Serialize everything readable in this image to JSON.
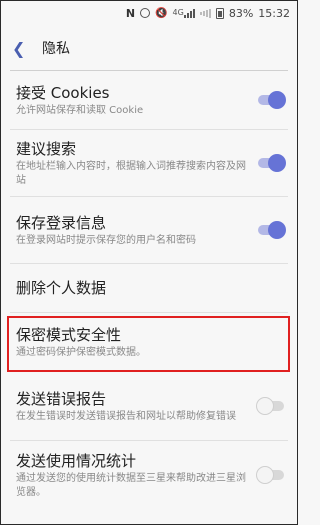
{
  "status_bar": {
    "nfc": "N",
    "signal_label": "4G",
    "battery_pct": "83%",
    "time": "15:32"
  },
  "header": {
    "back_icon": "back-chevron-icon",
    "title": "隐私"
  },
  "items": [
    {
      "title": "接受 Cookies",
      "subtitle": "允许网站保存和读取 Cookie",
      "toggle": "on"
    },
    {
      "title": "建议搜索",
      "subtitle": "在地址栏输入内容时，根据输入词推荐搜索内容及网站",
      "toggle": "on"
    },
    {
      "title": "保存登录信息",
      "subtitle": "在登录网站时提示保存您的用户名和密码",
      "toggle": "on"
    },
    {
      "title": "删除个人数据",
      "subtitle": "",
      "toggle": null
    },
    {
      "title": "保密模式安全性",
      "subtitle": "通过密码保护保密模式数据。",
      "toggle": null,
      "highlighted": true
    },
    {
      "title": "发送错误报告",
      "subtitle": "在发生错误时发送错误报告和网址以帮助修复错误",
      "toggle": "off"
    },
    {
      "title": "发送使用情况统计",
      "subtitle": "通过发送您的使用统计数据至三星来帮助改进三星浏览器。",
      "toggle": "off"
    }
  ],
  "colors": {
    "accent": "#6673d6",
    "highlight_border": "#e02020"
  }
}
